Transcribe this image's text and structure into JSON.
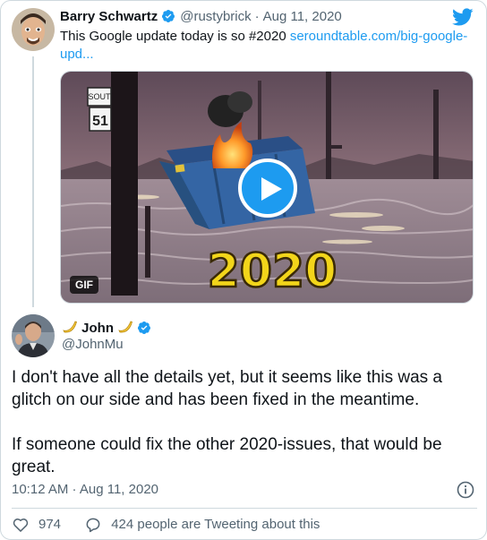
{
  "parent_tweet": {
    "author_name": "Barry Schwartz",
    "handle": "@rustybrick",
    "separator": "·",
    "date": "Aug 11, 2020",
    "text": "This Google update today is so #2020 ",
    "link": "seroundtable.com/big-google-upd...",
    "media": {
      "badge": "GIF",
      "caption": "2020",
      "sign_top": "SOUT",
      "sign_number": "51"
    }
  },
  "main_tweet": {
    "author_name": "John",
    "handle": "@JohnMu",
    "paragraphs": [
      "I don't have all the details yet, but it seems like this was a glitch on our side and has been fixed in the meantime.",
      "If someone could fix the other 2020-issues, that would be great."
    ],
    "timestamp": "10:12 AM · Aug 11, 2020",
    "likes": "974",
    "conversation": "424 people are Tweeting about this"
  },
  "colors": {
    "accent": "#1d9bf0",
    "text": "#0f1419",
    "secondary": "#536471",
    "border": "#cfd9de"
  },
  "icons": [
    "verified-badge-icon",
    "twitter-bird-icon",
    "play-icon",
    "banana-icon",
    "info-icon",
    "heart-icon",
    "reply-bubble-icon"
  ]
}
